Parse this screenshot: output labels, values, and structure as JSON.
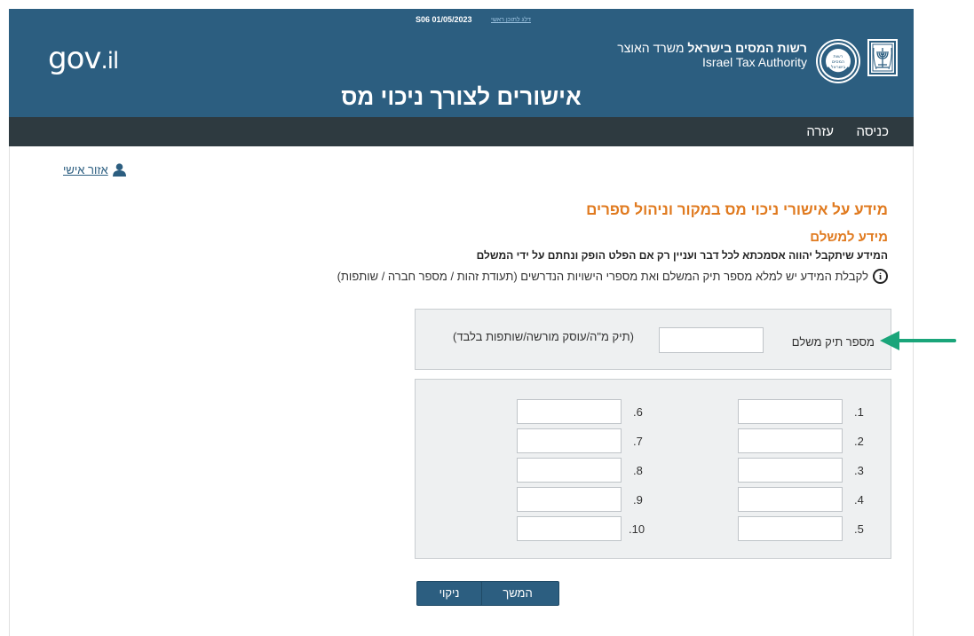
{
  "header": {
    "version": "S06 01/05/2023",
    "accessibility_link": "דלג לתוכן ראשי",
    "gov_logo": {
      "gov": "gov",
      "dot": ".",
      "il": "il"
    },
    "authority_he_bold": "רשות המסים בישראל",
    "authority_he_rest": "משרד האוצר",
    "authority_en": "Israel Tax Authority",
    "emblem_text": [
      "רשות",
      "המסים",
      "בישראל"
    ],
    "page_title": "אישורים לצורך ניכוי מס",
    "bg_color": "#2c5e80"
  },
  "nav": {
    "login": "כניסה",
    "help": "עזרה",
    "bg_color": "#2e3a40"
  },
  "content": {
    "personal_area": "אזור אישי",
    "section_title": "מידע על אישורי ניכוי מס במקור וניהול ספרים",
    "subsection_title": "מידע למשלם",
    "notice_bold": "המידע שיתקבל יהווה אסמכתא לכל דבר ועניין רק אם הפלט הופק ונחתם על ידי המשלם",
    "instruction": "לקבלת המידע יש למלא מספר תיק המשלם ואת מספרי הישויות הנדרשים (תעודת זהות / מספר חברה / שותפות)",
    "accent_color": "#e07a1f"
  },
  "payer": {
    "label": "מספר תיק משלם",
    "value": "",
    "hint": "(תיק מ\"ה/עוסק מורשה/שותפות בלבד)"
  },
  "entities": {
    "left": [
      {
        "label": ".6",
        "value": ""
      },
      {
        "label": ".7",
        "value": ""
      },
      {
        "label": ".8",
        "value": ""
      },
      {
        "label": ".9",
        "value": ""
      },
      {
        "label": ".10",
        "value": ""
      }
    ],
    "right": [
      {
        "label": ".1",
        "value": ""
      },
      {
        "label": ".2",
        "value": ""
      },
      {
        "label": ".3",
        "value": ""
      },
      {
        "label": ".4",
        "value": ""
      },
      {
        "label": ".5",
        "value": ""
      }
    ]
  },
  "buttons": {
    "continue": "המשך",
    "clear": "ניקוי"
  },
  "annotation": {
    "arrow_color": "#1aa57a"
  }
}
